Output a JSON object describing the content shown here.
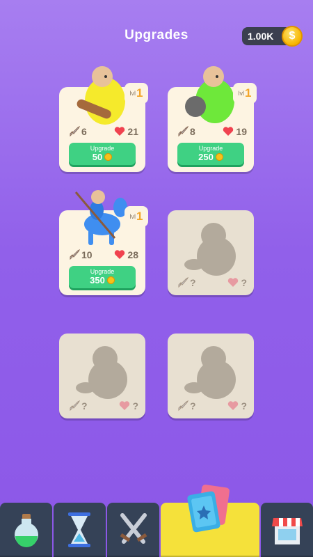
{
  "header": {
    "title": "Upgrades",
    "coins": "1.00K",
    "coin_symbol": "$"
  },
  "cards": [
    {
      "level_label": "lvl",
      "level": "1",
      "attack": "6",
      "health": "21",
      "button_label": "Upgrade",
      "price": "50",
      "color": "#f5ea2b"
    },
    {
      "level_label": "lvl",
      "level": "1",
      "attack": "8",
      "health": "19",
      "button_label": "Upgrade",
      "price": "250",
      "color": "#6ee83a"
    },
    {
      "level_label": "lvl",
      "level": "1",
      "attack": "10",
      "health": "28",
      "button_label": "Upgrade",
      "price": "350",
      "color": "#3f8ef0"
    },
    {
      "attack": "?",
      "health": "?"
    },
    {
      "attack": "?",
      "health": "?"
    },
    {
      "attack": "?",
      "health": "?"
    }
  ],
  "nav": {
    "tabs": [
      {
        "icon": "potion-icon"
      },
      {
        "icon": "hourglass-icon"
      },
      {
        "icon": "crossed-swords-icon"
      },
      {
        "icon": "cards-icon",
        "active": true
      },
      {
        "icon": "shop-icon"
      }
    ]
  }
}
